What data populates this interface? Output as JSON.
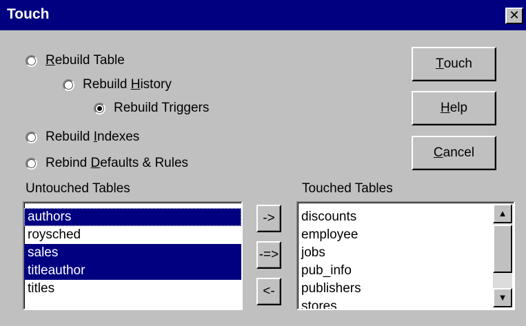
{
  "window": {
    "title": "Touch",
    "close_glyph": "✕"
  },
  "options": {
    "rebuild_table": {
      "pre": "",
      "mnemonic": "R",
      "post": "ebuild Table",
      "checked": false
    },
    "rebuild_history": {
      "pre": "Rebuild ",
      "mnemonic": "H",
      "post": "istory",
      "checked": false
    },
    "rebuild_triggers": {
      "pre": "Rebuild Tri",
      "mnemonic": "g",
      "post": "gers",
      "checked": true
    },
    "rebuild_indexes": {
      "pre": "Rebuild ",
      "mnemonic": "I",
      "post": "ndexes",
      "checked": false
    },
    "rebind_defaults": {
      "pre": "Rebind ",
      "mnemonic": "D",
      "post": "efaults & Rules",
      "checked": false
    }
  },
  "buttons": {
    "touch": {
      "mnemonic": "T",
      "post": "ouch"
    },
    "help": {
      "mnemonic": "H",
      "post": "elp"
    },
    "cancel": {
      "mnemonic": "C",
      "post": "ancel"
    },
    "move_selected": "->",
    "move_all": "-=>",
    "move_back": "<-"
  },
  "untouched": {
    "label": "Untouched Tables",
    "items": [
      {
        "text": "authors",
        "selected": true
      },
      {
        "text": "roysched",
        "selected": false
      },
      {
        "text": "sales",
        "selected": true
      },
      {
        "text": "titleauthor",
        "selected": true
      },
      {
        "text": "titles",
        "selected": false
      }
    ]
  },
  "touched": {
    "label": "Touched Tables",
    "items": [
      "discounts",
      "employee",
      "jobs",
      "pub_info",
      "publishers",
      "stores"
    ],
    "scroll_up_glyph": "▲",
    "scroll_down_glyph": "▼"
  }
}
